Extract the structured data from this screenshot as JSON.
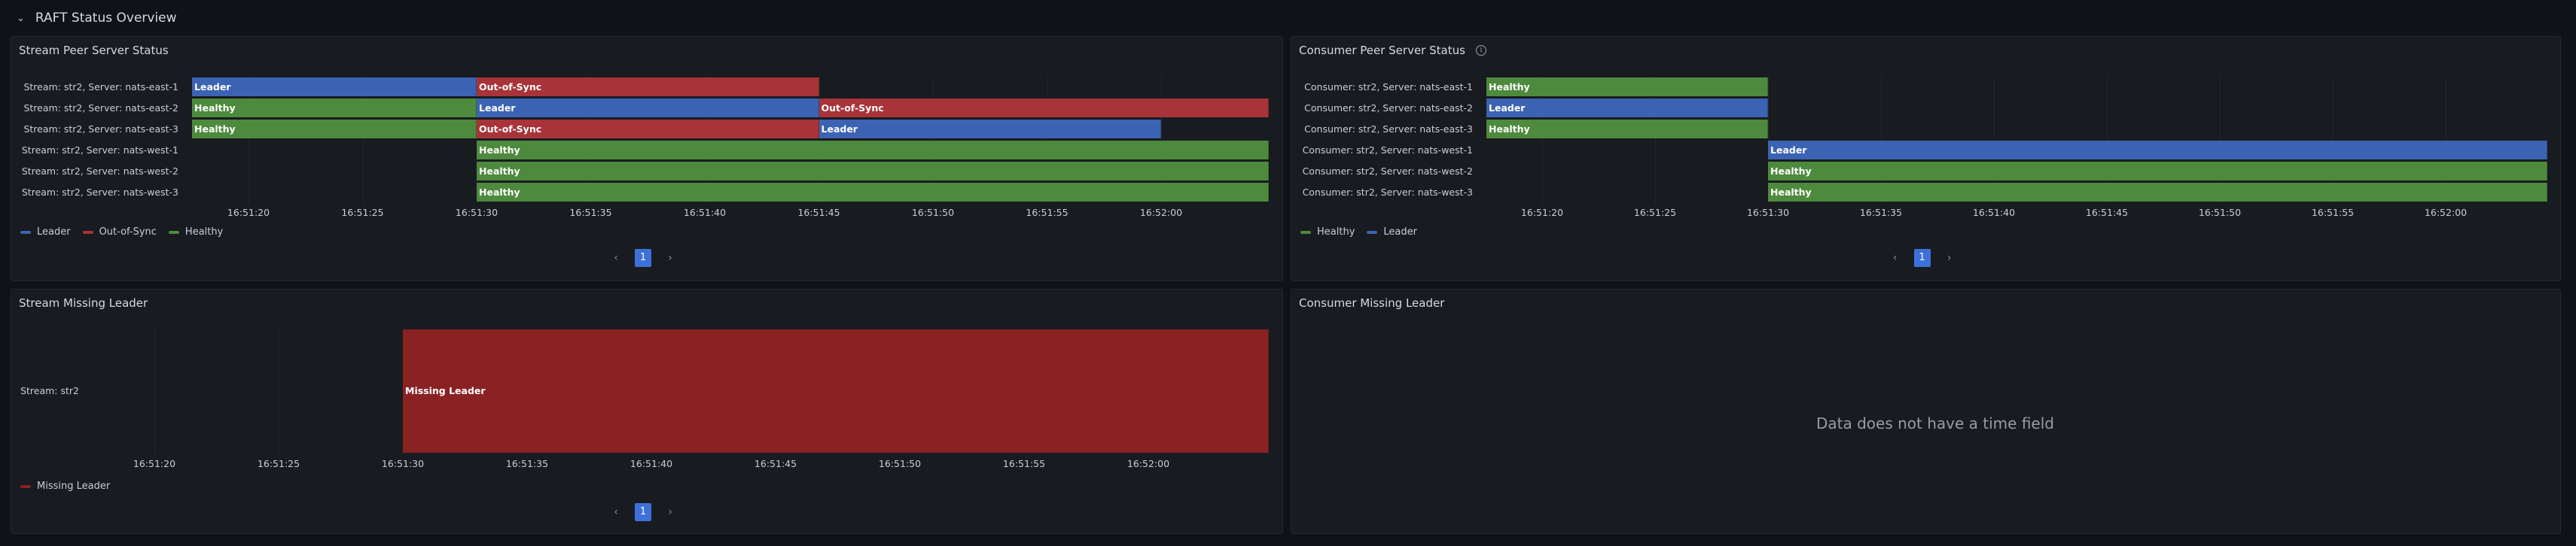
{
  "row_header": {
    "title": "RAFT Status Overview"
  },
  "colors": {
    "Leader": "#3c63b3",
    "Out-of-Sync": "#a83338",
    "Healthy": "#4e8a3d",
    "Missing Leader": "#8a2223",
    "grid": "#23262c"
  },
  "time_ticks": [
    "16:51:20",
    "16:51:25",
    "16:51:30",
    "16:51:35",
    "16:51:40",
    "16:51:45",
    "16:51:50",
    "16:51:55",
    "16:52:00"
  ],
  "stream_peer": {
    "title": "Stream Peer Server Status",
    "rows": [
      {
        "label": "Stream: str2, Server: nats-east-1",
        "segments": [
          {
            "state": "Leader",
            "start": "16:51:17.5",
            "end": "16:51:30"
          },
          {
            "state": "Out-of-Sync",
            "start": "16:51:30",
            "end": "16:51:45"
          }
        ]
      },
      {
        "label": "Stream: str2, Server: nats-east-2",
        "segments": [
          {
            "state": "Healthy",
            "start": "16:51:17.5",
            "end": "16:51:30"
          },
          {
            "state": "Leader",
            "start": "16:51:30",
            "end": "16:51:45"
          },
          {
            "state": "Out-of-Sync",
            "start": "16:51:45",
            "end": "16:52:05"
          }
        ]
      },
      {
        "label": "Stream: str2, Server: nats-east-3",
        "segments": [
          {
            "state": "Healthy",
            "start": "16:51:17.5",
            "end": "16:51:30"
          },
          {
            "state": "Out-of-Sync",
            "start": "16:51:30",
            "end": "16:51:45"
          },
          {
            "state": "Leader",
            "start": "16:51:45",
            "end": "16:52:00"
          }
        ]
      },
      {
        "label": "Stream: str2, Server: nats-west-1",
        "segments": [
          {
            "state": "Healthy",
            "start": "16:51:30",
            "end": "16:52:05"
          }
        ]
      },
      {
        "label": "Stream: str2, Server: nats-west-2",
        "segments": [
          {
            "state": "Healthy",
            "start": "16:51:30",
            "end": "16:52:05"
          }
        ]
      },
      {
        "label": "Stream: str2, Server: nats-west-3",
        "segments": [
          {
            "state": "Healthy",
            "start": "16:51:30",
            "end": "16:52:05"
          }
        ]
      }
    ],
    "legend": [
      "Leader",
      "Out-of-Sync",
      "Healthy"
    ],
    "page": "1"
  },
  "consumer_peer": {
    "title": "Consumer Peer Server Status",
    "rows": [
      {
        "label": "Consumer: str2, Server: nats-east-1",
        "segments": [
          {
            "state": "Healthy",
            "start": "16:51:17.5",
            "end": "16:51:30"
          }
        ]
      },
      {
        "label": "Consumer: str2, Server: nats-east-2",
        "segments": [
          {
            "state": "Leader",
            "start": "16:51:17.5",
            "end": "16:51:30"
          }
        ]
      },
      {
        "label": "Consumer: str2, Server: nats-east-3",
        "segments": [
          {
            "state": "Healthy",
            "start": "16:51:17.5",
            "end": "16:51:30"
          }
        ]
      },
      {
        "label": "Consumer: str2, Server: nats-west-1",
        "segments": [
          {
            "state": "Leader",
            "start": "16:51:30",
            "end": "16:52:05"
          }
        ]
      },
      {
        "label": "Consumer: str2, Server: nats-west-2",
        "segments": [
          {
            "state": "Healthy",
            "start": "16:51:30",
            "end": "16:52:05"
          }
        ]
      },
      {
        "label": "Consumer: str2, Server: nats-west-3",
        "segments": [
          {
            "state": "Healthy",
            "start": "16:51:30",
            "end": "16:52:05"
          }
        ]
      }
    ],
    "legend": [
      "Healthy",
      "Leader"
    ],
    "page": "1"
  },
  "stream_missing": {
    "title": "Stream Missing Leader",
    "rows": [
      {
        "label": "Stream: str2",
        "segments": [
          {
            "state": "Missing Leader",
            "start": "16:51:30",
            "end": "16:52:05"
          }
        ]
      }
    ],
    "legend": [
      "Missing Leader"
    ],
    "page": "1"
  },
  "consumer_missing": {
    "title": "Consumer Missing Leader",
    "message": "Data does not have a time field"
  },
  "pager_prev": "‹",
  "pager_next": "›"
}
